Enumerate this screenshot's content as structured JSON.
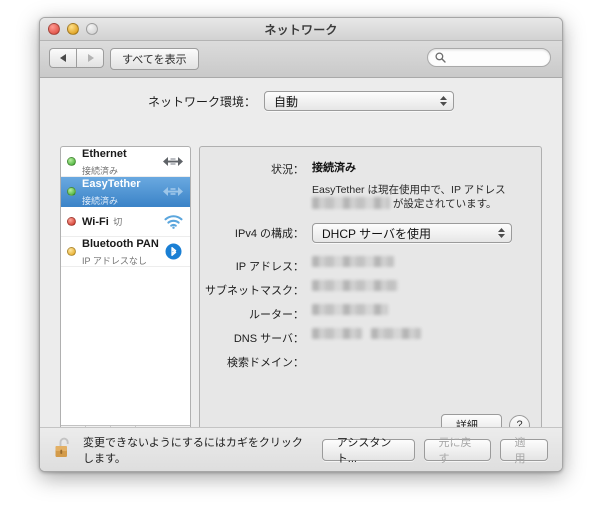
{
  "window": {
    "title": "ネットワーク",
    "traffic_lights": [
      "close",
      "minimize",
      "zoom"
    ]
  },
  "toolbar": {
    "back_icon": "triangle-left-icon",
    "forward_icon": "triangle-right-icon",
    "show_all_label": "すべてを表示",
    "search": {
      "placeholder": "",
      "value": "",
      "icon": "search-icon"
    }
  },
  "location": {
    "label": "ネットワーク環境：",
    "value": "自動"
  },
  "sidebar": {
    "services": [
      {
        "name": "Ethernet",
        "state": "接続済み",
        "status_color": "#37a427",
        "status_dot": "green",
        "icon": "ethernet-arrows-icon",
        "selected": false
      },
      {
        "name": "EasyTether",
        "state": "接続済み",
        "status_color": "#37a427",
        "status_dot": "green",
        "icon": "ethernet-arrows-icon",
        "selected": true
      },
      {
        "name": "Wi-Fi",
        "state": "切",
        "status_color": "#c8291b",
        "status_dot": "red",
        "icon": "wifi-icon",
        "selected": false
      },
      {
        "name": "Bluetooth PAN",
        "state": "IP アドレスなし",
        "status_color": "#e2a215",
        "status_dot": "amber",
        "icon": "bluetooth-icon",
        "selected": false
      }
    ],
    "footer": {
      "add_label": "+",
      "remove_label": "−",
      "gear_icon": "gear-icon"
    }
  },
  "details": {
    "status_label": "状況：",
    "status_value": "接続済み",
    "status_description_before": "EasyTether は現在使用中で、IP アドレス",
    "status_description_after": "が設定されています。",
    "ipv4_label": "IPv4 の構成：",
    "ipv4_value": "DHCP サーバを使用",
    "fields": [
      {
        "label": "IP アドレス：",
        "value": "",
        "redacted": true
      },
      {
        "label": "サブネットマスク：",
        "value": "",
        "redacted": true
      },
      {
        "label": "ルーター：",
        "value": "",
        "redacted": true
      },
      {
        "label": "DNS サーバ：",
        "value": "",
        "redacted": true
      },
      {
        "label": "検索ドメイン：",
        "value": "",
        "redacted": false
      }
    ],
    "advanced_label": "詳細...",
    "help_label": "?"
  },
  "footer": {
    "lock_icon": "unlocked-padlock-icon",
    "lock_note": "変更できないようにするにはカギをクリックします。",
    "assistant_label": "アシスタント...",
    "revert_label": "元に戻す",
    "apply_label": "適用"
  }
}
